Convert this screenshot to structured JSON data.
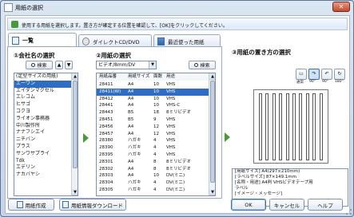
{
  "window": {
    "title": "用紙の選択",
    "close_label": "✕"
  },
  "banner": {
    "text": "使用する用紙を選択します。置き方が確定する位置を確認して、[OK]をクリックしてください。"
  },
  "tabs": [
    {
      "label": "一覧"
    },
    {
      "label": "ダイレクトCD/DVD"
    },
    {
      "label": "最近使った用紙"
    }
  ],
  "company": {
    "title": "①会社名の選択",
    "search_label": "検索",
    "up_label": "▲",
    "down_label": "▼",
    "items": [
      "(定型サイズの用紙)",
      "エーワン",
      "エイダンマクセル",
      "エレコム",
      "ヒサゴ",
      "コクヨ",
      "ライオン事務器",
      "中川製作所",
      "ナナフシエイ",
      "ニチバン",
      "プラス",
      "サンワサプライ",
      "Tdk",
      "エデリン",
      "ナカバヤシ"
    ],
    "selected_index": 1,
    "scroll_up": "▲",
    "scroll_down": "▼"
  },
  "paper": {
    "title": "②用紙の選択",
    "filter_value": "ビデオ/8mm/DV",
    "filter_arrow": "▼",
    "search_label": "検索",
    "columns": [
      "用紙品番",
      "用紙サイズ",
      "面数",
      "用途"
    ],
    "rows": [
      [
        "28411",
        "A4",
        "10",
        "VHS"
      ],
      [
        "28411(W)",
        "A4",
        "10",
        "VHS"
      ],
      [
        "28412",
        "A4",
        "10",
        "VHS"
      ],
      [
        "28441",
        "A4",
        "10",
        "VHS-C"
      ],
      [
        "28443",
        "B5",
        "18",
        "8ミリビデオ"
      ],
      [
        "28451",
        "B5",
        "9",
        "VHS"
      ],
      [
        "28456",
        "A4",
        "12",
        "VHS"
      ],
      [
        "28457",
        "A4",
        "12",
        "VHS"
      ],
      [
        "28380",
        "ハガキ",
        "4",
        "VHS"
      ],
      [
        "28390",
        "ハガキ",
        "4",
        "VHS"
      ],
      [
        "28395",
        "ハガキ",
        "4",
        "VHS"
      ],
      [
        "28301",
        "A4",
        "8",
        "8ミリビデオ"
      ],
      [
        "28302",
        "A4",
        "8",
        "8ミリビデオ"
      ],
      [
        "28303",
        "A4",
        "10",
        "DV(ミニ)"
      ],
      [
        "28304",
        "ハガキ",
        "4",
        "DV(ミニ)"
      ],
      [
        "28305",
        "ハガキ",
        "4",
        "DV(ミニ)"
      ]
    ],
    "selected_index": 1,
    "scroll_up": "▲",
    "scroll_down": "▼"
  },
  "orientation": {
    "title": "③用紙の置き方の選択",
    "options": [
      {
        "label": "通常",
        "glyph": "▭"
      },
      {
        "label": "90°",
        "glyph": "↷"
      },
      {
        "label": "90°",
        "glyph": "↶"
      },
      {
        "label": "180°",
        "glyph": "↻"
      }
    ],
    "active_index": 1
  },
  "info": {
    "lines": [
      "[用紙サイズ] A4(297×210mm)",
      "[ラベルサイズ] 87×149.1mm",
      "[名称・用途] A4判 VHSビデオテープ用",
      "ラベル",
      "",
      "[イメージ・メッセージ]"
    ]
  },
  "footer": {
    "create_label": "用紙作成",
    "download_label": "用紙情報ダウンロード",
    "ok_label": "OK",
    "cancel_label": "キャンセル",
    "help_label": "ヘルプ"
  },
  "colors": {
    "accent": "#2f6cc4",
    "arrow": "#4a9a3a"
  }
}
